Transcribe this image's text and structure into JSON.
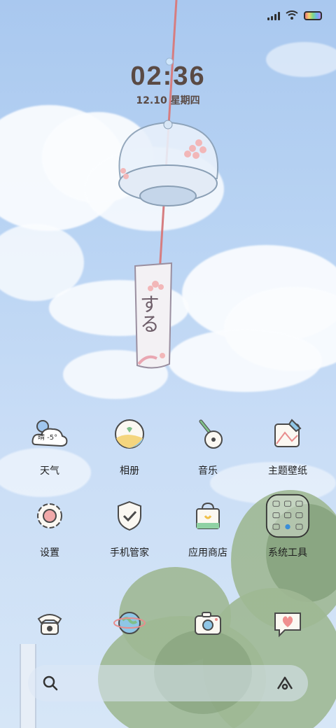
{
  "status_bar": {
    "signal_icon": "signal-bars-icon",
    "wifi_icon": "wifi-icon",
    "battery_icon": "rainbow-battery-icon"
  },
  "clock": {
    "time": "02:36",
    "date": "12.10 星期四"
  },
  "wallpaper": {
    "chime_text": "する"
  },
  "apps": [
    {
      "label": "天气",
      "icon": "weather-icon",
      "badge": "晴 -5°"
    },
    {
      "label": "相册",
      "icon": "gallery-icon"
    },
    {
      "label": "音乐",
      "icon": "guitar-music-icon"
    },
    {
      "label": "主题壁纸",
      "icon": "themes-wallpaper-icon"
    },
    {
      "label": "设置",
      "icon": "settings-gear-icon"
    },
    {
      "label": "手机管家",
      "icon": "security-shield-icon"
    },
    {
      "label": "应用商店",
      "icon": "app-store-bag-icon"
    },
    {
      "label": "系统工具",
      "icon": "system-tools-folder-icon"
    }
  ],
  "dock": [
    {
      "icon": "phone-icon"
    },
    {
      "icon": "browser-globe-icon"
    },
    {
      "icon": "camera-icon"
    },
    {
      "icon": "messages-heart-icon"
    }
  ],
  "search_bar": {
    "left_icon": "search-icon",
    "right_icon": "assistant-icon"
  }
}
